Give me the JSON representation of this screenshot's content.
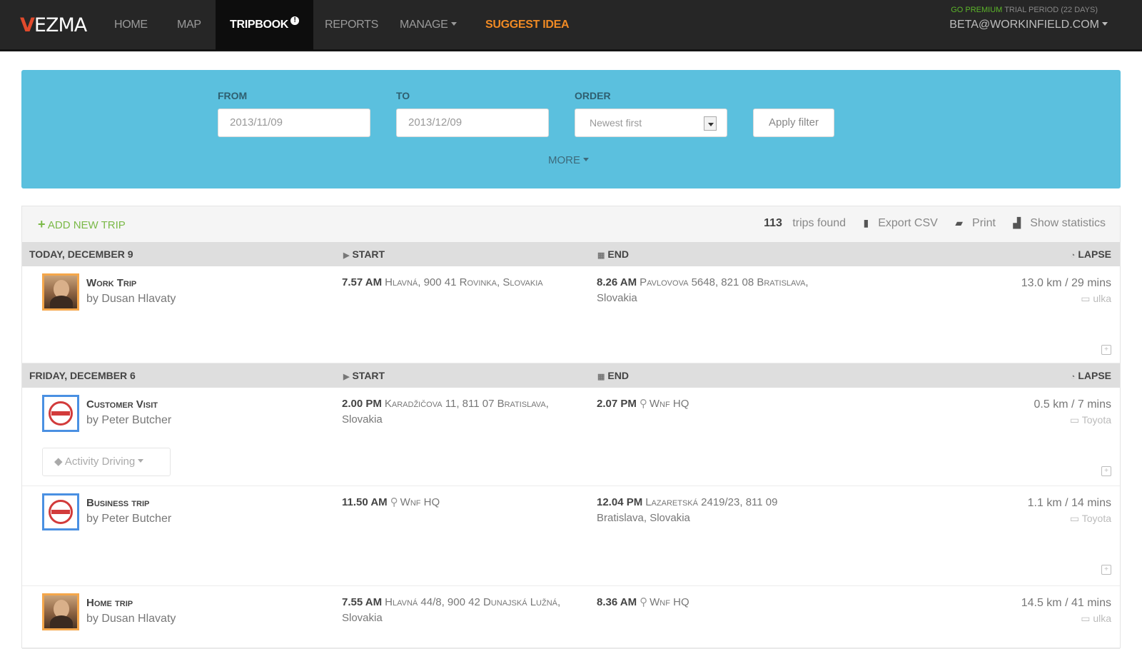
{
  "brand": {
    "logo_v": "V",
    "logo_rest": "EZMA"
  },
  "nav": {
    "items": [
      {
        "label": "Home"
      },
      {
        "label": "Map"
      },
      {
        "label": "Tripbook",
        "badge": "!"
      },
      {
        "label": "Reports"
      },
      {
        "label": "Manage"
      },
      {
        "label": "Suggest idea"
      }
    ],
    "premium_go": "Go premium",
    "premium_rest": "trial period (22 days)",
    "account": "beta@workinfield.com"
  },
  "filter": {
    "from_label": "From",
    "from_value": "2013/11/09",
    "to_label": "To",
    "to_value": "2013/12/09",
    "order_label": "Order",
    "order_value": "Newest first",
    "apply_label": "Apply filter",
    "more_label": "More"
  },
  "toolbar": {
    "add_trip": "Add new trip",
    "count": "113",
    "count_suffix": "trips found",
    "export_label": "Export CSV",
    "print_label": "Print",
    "stats_label": "Show statistics"
  },
  "columns": {
    "start": "Start",
    "end": "End",
    "lapse": "Lapse"
  },
  "days": [
    {
      "date": "Today, December 9",
      "trips": [
        {
          "type": "Work Trip",
          "driver": "by Dusan Hlavaty",
          "start_time": "7.57 AM",
          "start_addr": "Hlavná, 900 41 Rovinka, Slovakia",
          "end_time": "8.26 AM",
          "end_addr_1": "Pavlovova 5648, 821 08 Bratislava,",
          "end_addr_2": "Slovakia",
          "distance": "13.0 km / 29 mins",
          "car": "ulka"
        }
      ]
    },
    {
      "date": "Friday, December 6",
      "trips": [
        {
          "type": "Customer Visit",
          "driver": "by Peter Butcher",
          "start_time": "2.00 PM",
          "start_addr_1": "Karadžičova 11, 811 07 Bratislava,",
          "start_addr_2": "Slovakia",
          "end_time": "2.07 PM",
          "end_addr": "Wnf HQ",
          "distance": "0.5 km / 7 mins",
          "car": "Toyota",
          "activity": "Activity Driving"
        },
        {
          "type": "Business trip",
          "driver": "by Peter Butcher",
          "start_time": "11.50 AM",
          "start_addr": "Wnf HQ",
          "end_time": "12.04 PM",
          "end_addr_1": "Lazaretská 2419/23, 811 09",
          "end_addr_2": "Bratislava, Slovakia",
          "distance": "1.1 km / 14 mins",
          "car": "Toyota"
        },
        {
          "type": "Home trip",
          "driver": "by Dusan Hlavaty",
          "start_time": "7.55 AM",
          "start_addr_1": "Hlavná 44/8, 900 42 Dunajská Lužná,",
          "start_addr_2": "Slovakia",
          "end_time": "8.36 AM",
          "end_addr": "Wnf HQ",
          "distance": "14.5 km / 41 mins",
          "car": "ulka"
        }
      ]
    }
  ]
}
